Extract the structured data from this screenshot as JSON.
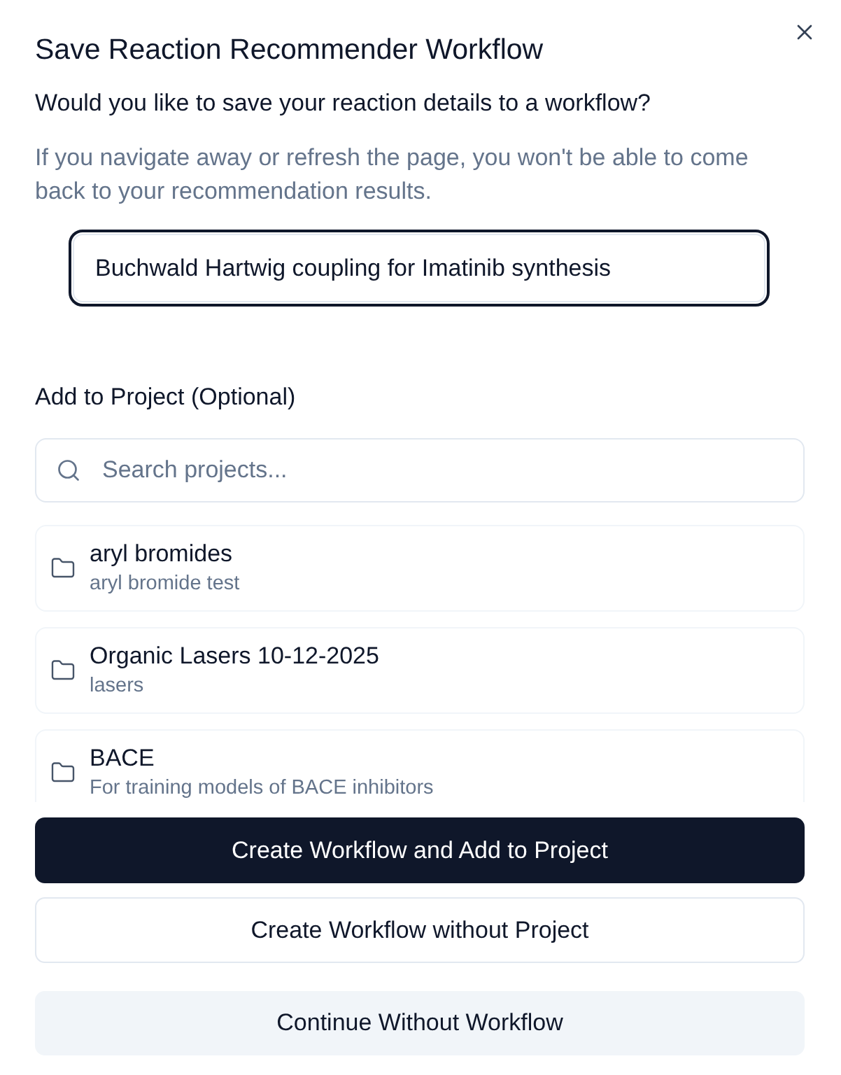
{
  "dialog": {
    "title": "Save Reaction Recommender Workflow",
    "subtitle": "Would you like to save your reaction details to a workflow?",
    "warning": "If you navigate away or refresh the page, you won't be able to come back to your recommendation results."
  },
  "name_field": {
    "value": "Buchwald Hartwig coupling for Imatinib synthesis",
    "focused": true
  },
  "project_section": {
    "label": "Add to Project (Optional)",
    "search": {
      "placeholder": "Search projects..."
    },
    "projects": [
      {
        "name": "aryl bromides",
        "description": "aryl bromide test",
        "selected": false
      },
      {
        "name": "Organic Lasers 10-12-2025",
        "description": "lasers",
        "selected": false
      },
      {
        "name": "BACE",
        "description": "For training models of BACE inhibitors",
        "selected": false
      }
    ]
  },
  "buttons": [
    {
      "label": "Create Workflow and Add to Project",
      "kind": "primary"
    },
    {
      "label": "Create Workflow without Project",
      "kind": "outline"
    },
    {
      "label": "Continue Without Workflow",
      "kind": "secondary"
    }
  ]
}
